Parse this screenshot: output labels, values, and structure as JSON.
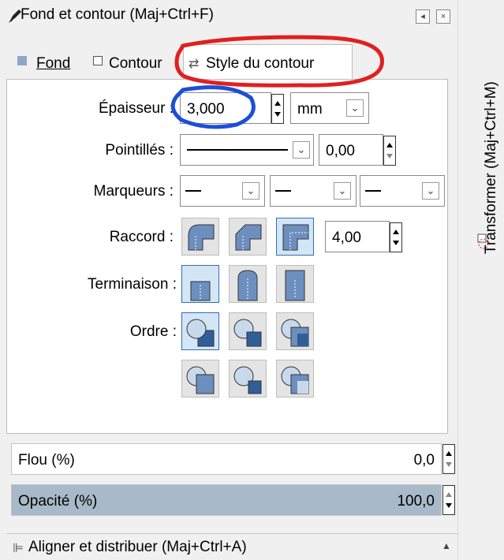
{
  "window": {
    "title": "Fond et contour (Maj+Ctrl+F)"
  },
  "side_dock": {
    "label": "Transformer (Maj+Ctrl+M)"
  },
  "tabs": [
    {
      "label": "Fond"
    },
    {
      "label": "Contour"
    },
    {
      "label": "Style du contour"
    }
  ],
  "stroke_style": {
    "width_label": "Épaisseur :",
    "width_value": "3,000",
    "unit": "mm",
    "dashes_label": "Pointillés :",
    "dash_offset": "0,00",
    "markers_label": "Marqueurs :",
    "join_label": "Raccord :",
    "miter_limit": "4,00",
    "cap_label": "Terminaison :",
    "order_label": "Ordre :"
  },
  "blur": {
    "label": "Flou (%)",
    "value": "0,0"
  },
  "opacity": {
    "label": "Opacité (%)",
    "value": "100,0",
    "fraction": 1.0
  },
  "align_panel": {
    "label": "Aligner et distribuer (Maj+Ctrl+A)"
  },
  "annotations": {
    "highlight_tab_color": "#e02020",
    "highlight_width_color": "#1c4fd8"
  }
}
